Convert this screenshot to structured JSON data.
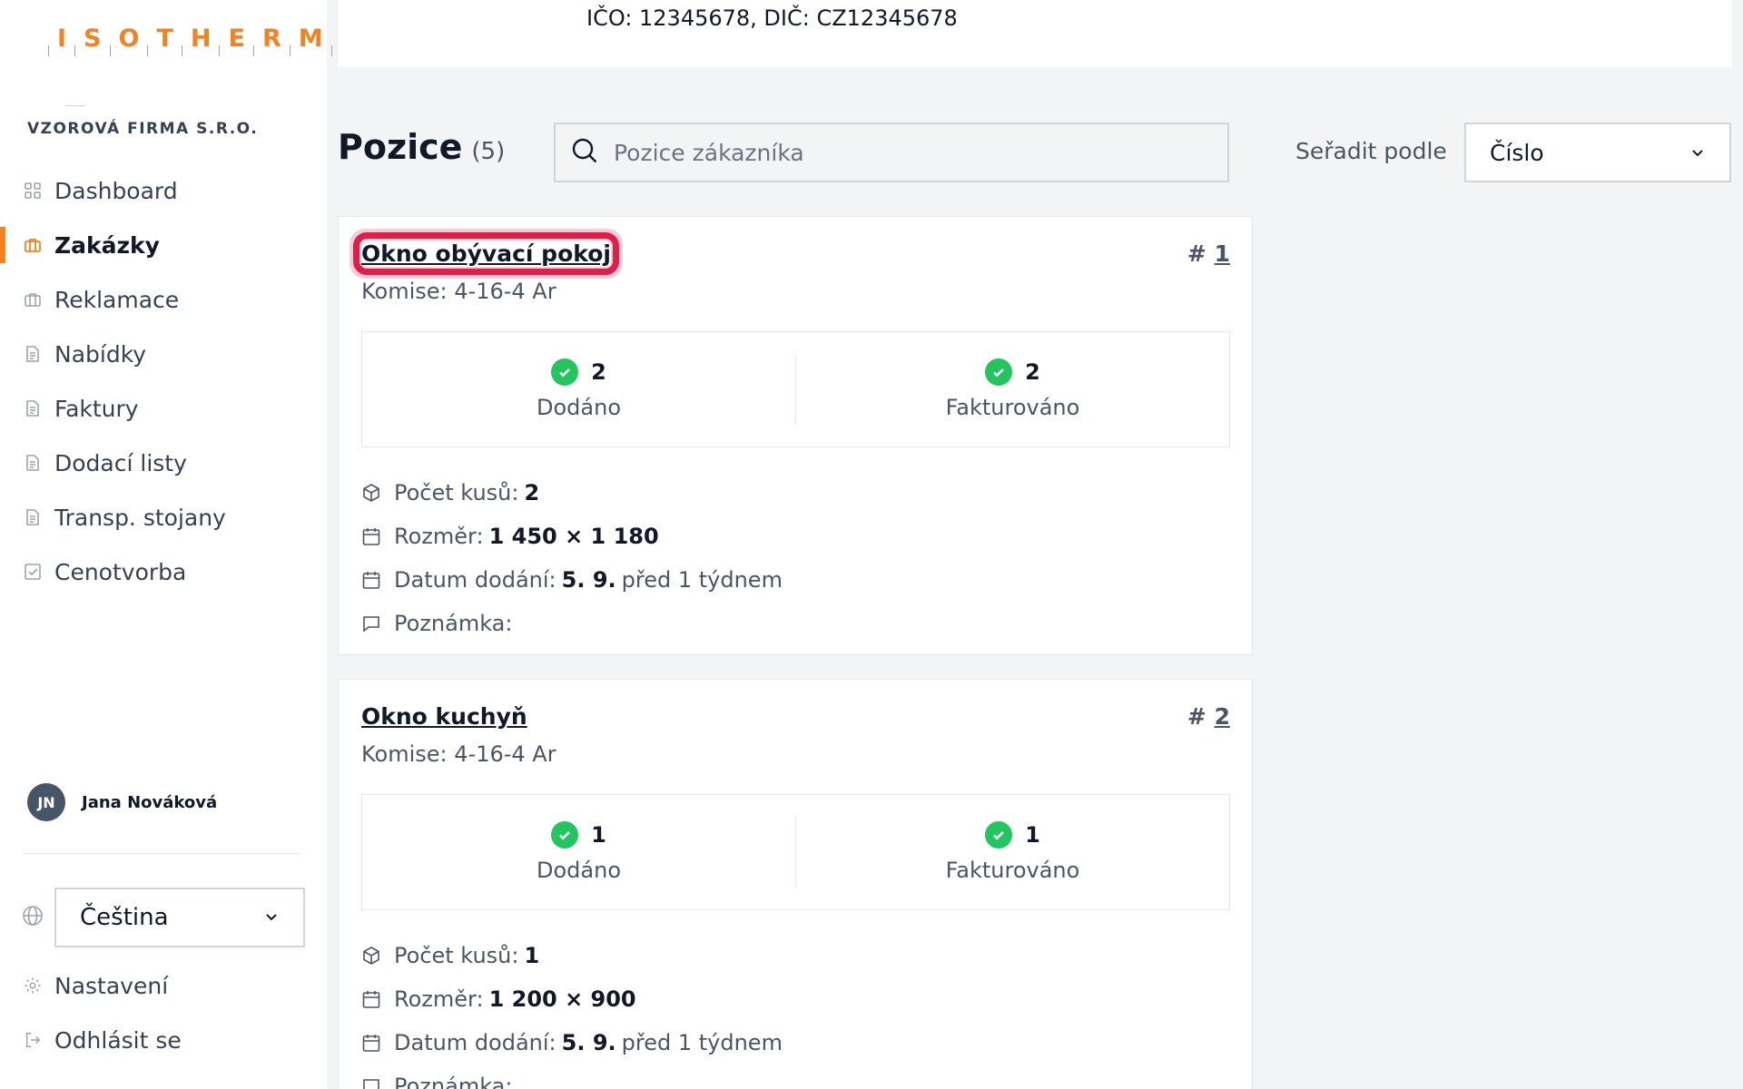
{
  "logo": {
    "letters": [
      "I",
      "S",
      "O",
      "T",
      "H",
      "E",
      "R",
      "M"
    ],
    "brand_color": "#f5821f"
  },
  "sidebar": {
    "company": "VZOROVÁ FIRMA S.R.O.",
    "items": [
      {
        "label": "Dashboard",
        "icon": "grid-icon"
      },
      {
        "label": "Zakázky",
        "icon": "briefcase-icon",
        "active": true
      },
      {
        "label": "Reklamace",
        "icon": "briefcase-icon"
      },
      {
        "label": "Nabídky",
        "icon": "document-icon"
      },
      {
        "label": "Faktury",
        "icon": "document-icon"
      },
      {
        "label": "Dodací listy",
        "icon": "document-icon"
      },
      {
        "label": "Transp. stojany",
        "icon": "document-icon"
      },
      {
        "label": "Cenotvorba",
        "icon": "checkbox-icon"
      }
    ],
    "user": {
      "initials": "JN",
      "name": "Jana Nováková"
    },
    "language": "Čeština",
    "settings_label": "Nastavení",
    "logout_label": "Odhlásit se"
  },
  "header": {
    "company_ids": "IČO: 12345678, DIČ: CZ12345678"
  },
  "positions": {
    "title": "Pozice",
    "count": "(5)",
    "search_placeholder": "Pozice zákazníka",
    "sort_label": "Seřadit podle",
    "sort_value": "Číslo"
  },
  "cards": [
    {
      "title": "Okno obývací pokoj",
      "hash": "#",
      "number": "1",
      "commission": "Komise: 4-16-4 Ar",
      "delivered_count": "2",
      "delivered_label": "Dodáno",
      "invoiced_count": "2",
      "invoiced_label": "Fakturováno",
      "pieces_label": "Počet kusů:",
      "pieces": "2",
      "size_label": "Rozměr:",
      "size": "1 450 × 1 180",
      "date_label": "Datum dodání:",
      "date": "5. 9.",
      "date_relative": "před 1 týdnem",
      "note_label": "Poznámka:"
    },
    {
      "title": "Okno kuchyň",
      "hash": "#",
      "number": "2",
      "commission": "Komise: 4-16-4 Ar",
      "delivered_count": "1",
      "delivered_label": "Dodáno",
      "invoiced_count": "1",
      "invoiced_label": "Fakturováno",
      "pieces_label": "Počet kusů:",
      "pieces": "1",
      "size_label": "Rozměr:",
      "size": "1 200 × 900",
      "date_label": "Datum dodání:",
      "date": "5. 9.",
      "date_relative": "před 1 týdnem",
      "note_label": "Poznámka:"
    }
  ],
  "colors": {
    "accent": "#f5821f",
    "success": "#22c55e",
    "highlight": "#e11d48"
  }
}
